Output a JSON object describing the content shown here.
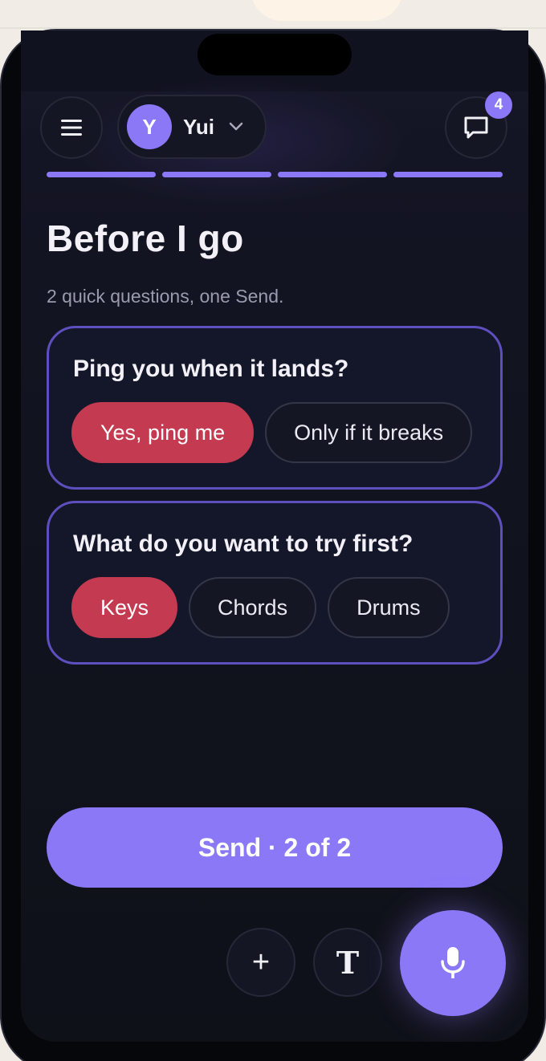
{
  "header": {
    "menu_icon": "hamburger-menu-icon",
    "user": {
      "initial": "Y",
      "name": "Yui"
    },
    "chat_icon": "chat-bubble-icon",
    "notification_count": "4"
  },
  "progress": {
    "segments": 4,
    "completed": 4
  },
  "page": {
    "title": "Before I go",
    "subtitle": "2 quick questions, one Send."
  },
  "questions": [
    {
      "text": "Ping you when it lands?",
      "options": [
        "Yes, ping me",
        "Only if it breaks"
      ],
      "selected": "Yes, ping me"
    },
    {
      "text": "What do you want to try first?",
      "options": [
        "Keys",
        "Chords",
        "Drums"
      ],
      "selected": "Keys"
    }
  ],
  "send_button": {
    "label": "Send · 2 of 2"
  },
  "toolbar": {
    "plus_label": "+",
    "text_label": "T",
    "mic_icon": "microphone-icon"
  },
  "colors": {
    "accent": "#8a78f7",
    "selected_chip": "#c43a50",
    "card_border": "#5d4fbe",
    "background": "#11131f"
  }
}
